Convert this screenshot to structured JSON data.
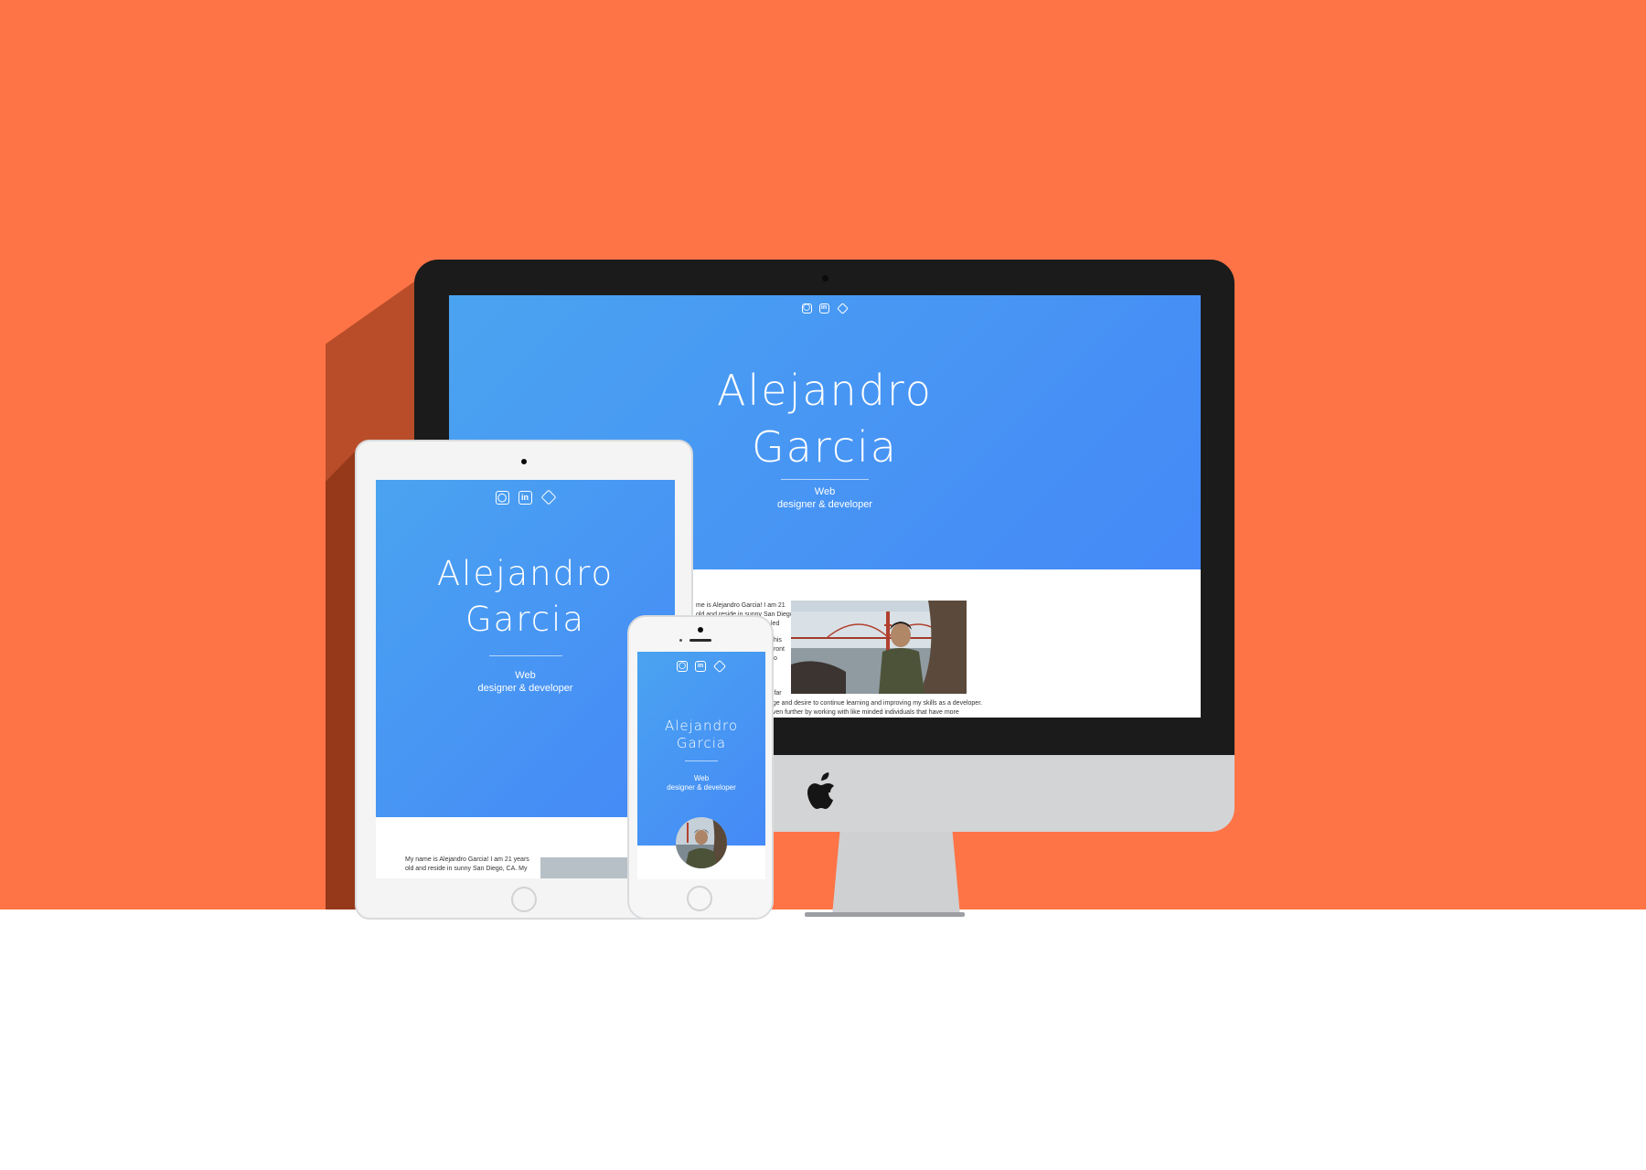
{
  "colors": {
    "background": "#fe7446",
    "hero_gradient_start": "#4aa3f0",
    "hero_gradient_end": "#4589f7",
    "device_bezel": "#1b1b1b",
    "device_silver": "#d3d4d6"
  },
  "social_icons": [
    "github-icon",
    "linkedin-icon",
    "codepen-icon"
  ],
  "social_glyphs": {
    "github": "◯",
    "linkedin": "in",
    "codepen": "◇"
  },
  "site": {
    "name_line1": "Alejandro",
    "name_line2": "Garcia",
    "subtitle_line1": "Web",
    "subtitle_line2": "designer & developer",
    "bio_fragments": [
      "me is Alejandro Garcia! I am 21",
      "old and reside in sunny San Diego,",
      "led",
      "this",
      "front",
      "to",
      "s far",
      "dge and desire to continue learning and improving my skills as a developer.",
      "even further by working with like minded individuals that have more"
    ],
    "bio_tablet": [
      "My name is Alejandro Garcia! I am 21 years",
      "old and reside in sunny San Diego, CA. My"
    ]
  }
}
